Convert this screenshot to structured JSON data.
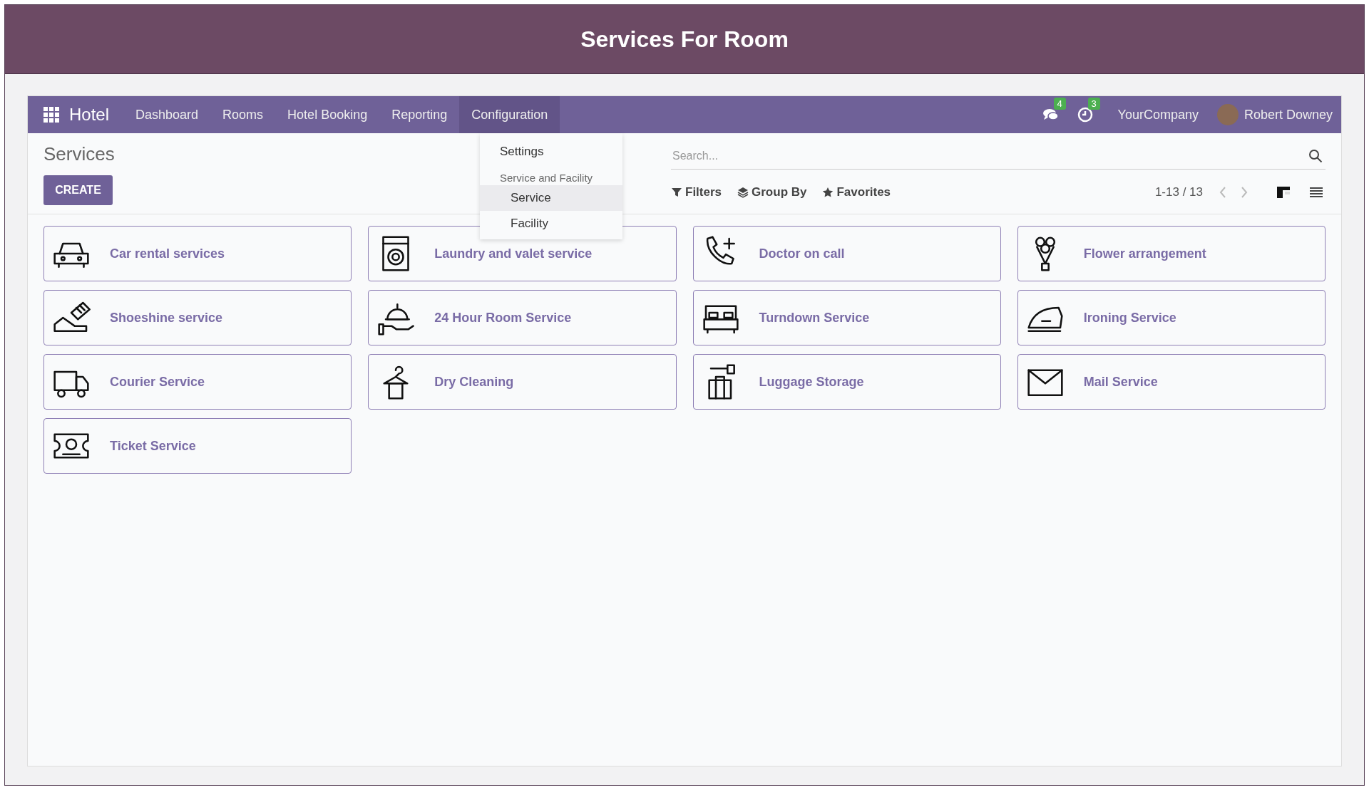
{
  "page_title": "Services For Room",
  "navbar": {
    "app_name": "Hotel",
    "menu": [
      {
        "label": "Dashboard",
        "selected": false
      },
      {
        "label": "Rooms",
        "selected": false
      },
      {
        "label": "Hotel Booking",
        "selected": false
      },
      {
        "label": "Reporting",
        "selected": false
      },
      {
        "label": "Configuration",
        "selected": true
      }
    ],
    "messages_count": "4",
    "activities_count": "3",
    "company": "YourCompany",
    "user": "Robert Downey"
  },
  "dropdown": {
    "items": [
      {
        "kind": "item",
        "label": "Settings",
        "selected": false
      },
      {
        "kind": "header",
        "label": "Service and Facility"
      },
      {
        "kind": "subitem",
        "label": "Service",
        "selected": true
      },
      {
        "kind": "subitem",
        "label": "Facility",
        "selected": false
      }
    ]
  },
  "control_panel": {
    "title": "Services",
    "create_button": "CREATE",
    "search": {
      "placeholder": "Search..."
    },
    "filters": [
      "Filters",
      "Group By",
      "Favorites"
    ],
    "pager": "1-13 / 13",
    "views": [
      {
        "kind": "kanban",
        "selected": true
      },
      {
        "kind": "list",
        "selected": false
      }
    ]
  },
  "cards": [
    {
      "name": "Car rental services"
    },
    {
      "name": "Laundry and valet service"
    },
    {
      "name": "Doctor on call"
    },
    {
      "name": "Flower arrangement"
    },
    {
      "name": "Shoeshine service"
    },
    {
      "name": "24 Hour Room Service"
    },
    {
      "name": "Turndown Service"
    },
    {
      "name": "Ironing Service"
    },
    {
      "name": "Courier Service"
    },
    {
      "name": "Dry Cleaning"
    },
    {
      "name": "Luggage Storage"
    },
    {
      "name": "Mail Service"
    },
    {
      "name": "Ticket Service"
    }
  ]
}
